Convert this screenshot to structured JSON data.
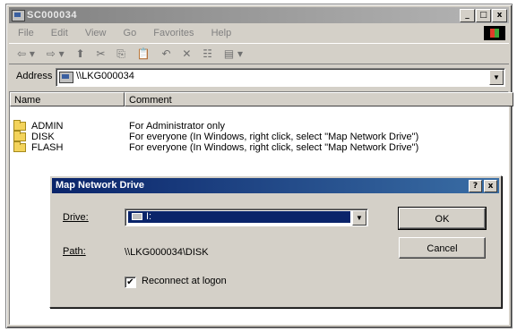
{
  "window": {
    "title": "SC000034",
    "buttons": [
      "_",
      "□",
      "x"
    ]
  },
  "menu": [
    "File",
    "Edit",
    "View",
    "Go",
    "Favorites",
    "Help"
  ],
  "toolbar": {
    "icons": [
      "back-icon",
      "forward-icon",
      "up-icon",
      "cut-icon",
      "copy-icon",
      "paste-icon",
      "undo-icon",
      "delete-icon",
      "properties-icon",
      "views-icon"
    ],
    "glyphs": [
      "⇦ ▾",
      "⇨ ▾",
      "⬆",
      "✂",
      "⎘",
      "📋",
      "↶",
      "✕",
      "☷",
      "▤ ▾"
    ]
  },
  "address": {
    "label": "Address",
    "value": "\\\\LKG000034"
  },
  "list": {
    "columns": [
      "Name",
      "Comment"
    ],
    "rows": [
      {
        "name": "ADMIN",
        "comment": "For Administrator only"
      },
      {
        "name": "DISK",
        "comment": "For everyone (In Windows, right click, select \"Map Network Drive\")"
      },
      {
        "name": "FLASH",
        "comment": "For everyone (In Windows, right click, select \"Map Network Drive\")"
      }
    ]
  },
  "dialog": {
    "title": "Map Network Drive",
    "title_buttons": [
      "?",
      "x"
    ],
    "drive_label": "Drive:",
    "drive_value": "I:",
    "path_label": "Path:",
    "path_value": "\\\\LKG000034\\DISK",
    "reconnect_label": "Reconnect at logon",
    "reconnect_checked": true,
    "ok_label": "OK",
    "cancel_label": "Cancel"
  },
  "colors": {
    "dialog_title_start": "#0a246a",
    "dialog_title_end": "#3a6ea5",
    "window_face": "#d4d0c8",
    "folder": "#f3d35b"
  }
}
